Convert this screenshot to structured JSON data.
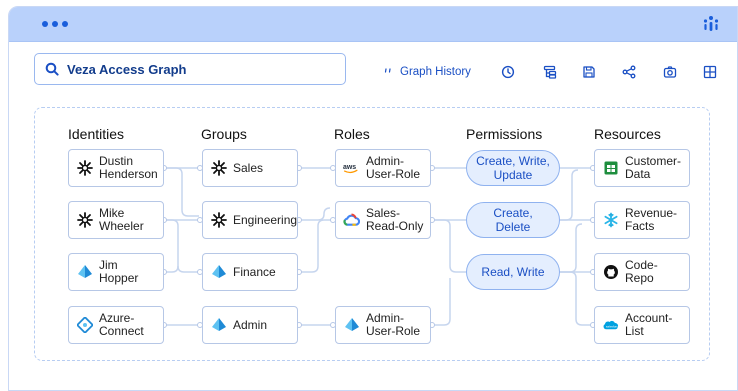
{
  "window": {
    "brand_icon": "veza-logo",
    "accent": "#1a5edb"
  },
  "search": {
    "icon": "search-icon",
    "text": "Veza Access Graph"
  },
  "toolbar": {
    "history_label": "Graph History",
    "icons": [
      "graph-history-icon",
      "clock-icon",
      "hierarchy-icon",
      "save-icon",
      "share-icon",
      "camera-icon",
      "grid-icon"
    ]
  },
  "columns": {
    "identities": "Identities",
    "groups": "Groups",
    "roles": "Roles",
    "permissions": "Permissions",
    "resources": "Resources"
  },
  "identities": [
    {
      "label": "Dustin\nHenderson",
      "icon": "okta-icon"
    },
    {
      "label": "Mike\nWheeler",
      "icon": "okta-icon"
    },
    {
      "label": "Jim\nHopper",
      "icon": "azure-ad-icon"
    },
    {
      "label": "Azure-\nConnect",
      "icon": "azure-connect-icon"
    }
  ],
  "groups": [
    {
      "label": "Sales",
      "icon": "okta-icon"
    },
    {
      "label": "Engineering",
      "icon": "okta-icon"
    },
    {
      "label": "Finance",
      "icon": "azure-ad-icon"
    },
    {
      "label": "Admin",
      "icon": "azure-ad-icon"
    }
  ],
  "roles": [
    {
      "label": "Admin-\nUser-Role",
      "icon": "aws-icon"
    },
    {
      "label": "Sales-\nRead-Only",
      "icon": "google-cloud-icon"
    },
    {
      "label": "Admin-\nUser-Role",
      "icon": "azure-ad-icon"
    }
  ],
  "permissions": [
    {
      "label": "Create, Write,\nUpdate"
    },
    {
      "label": "Create,\nDelete"
    },
    {
      "label": "Read, Write"
    }
  ],
  "resources": [
    {
      "label": "Customer-\nData",
      "icon": "google-sheets-icon"
    },
    {
      "label": "Revenue-\nFacts",
      "icon": "snowflake-icon"
    },
    {
      "label": "Code-\nRepo",
      "icon": "github-icon"
    },
    {
      "label": "Account-\nList",
      "icon": "salesforce-icon"
    }
  ]
}
